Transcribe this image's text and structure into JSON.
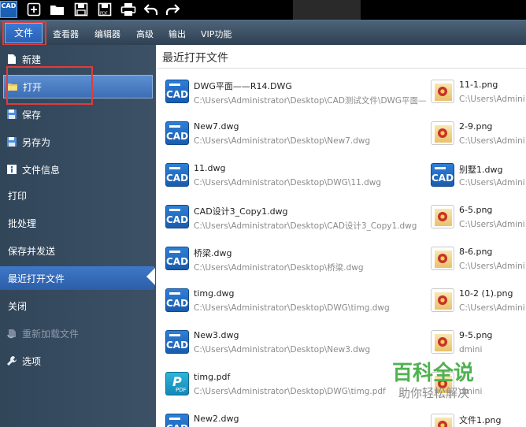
{
  "toolbar": {
    "logo_text": "CAD",
    "icons": [
      "new-icon",
      "open-folder-icon",
      "save-icon",
      "save-pdf-icon",
      "print-icon",
      "undo-icon",
      "redo-icon"
    ]
  },
  "menu": {
    "items": [
      "文件",
      "查看器",
      "编辑器",
      "高级",
      "输出",
      "VIP功能"
    ]
  },
  "sidebar": {
    "items": [
      {
        "label": "新建",
        "icon": "new-file-icon"
      },
      {
        "label": "打开",
        "icon": "open-folder-icon"
      },
      {
        "label": "保存",
        "icon": "save-icon"
      },
      {
        "label": "另存为",
        "icon": "save-as-icon"
      },
      {
        "label": "文件信息",
        "icon": "info-icon"
      },
      {
        "label": "打印"
      },
      {
        "label": "批处理"
      },
      {
        "label": "保存并发送"
      },
      {
        "label": "最近打开文件"
      },
      {
        "label": "关闭"
      },
      {
        "label": "重新加载文件",
        "icon": "reload-icon"
      },
      {
        "label": "选项",
        "icon": "wrench-icon"
      }
    ]
  },
  "recent": {
    "title": "最近打开文件",
    "left_files": [
      {
        "name": "DWG平面——R14.DWG",
        "path": "C:\\Users\\Administrator\\Desktop\\CAD测试文件\\DWG平面—",
        "type": "cad"
      },
      {
        "name": "New7.dwg",
        "path": "C:\\Users\\Administrator\\Desktop\\New7.dwg",
        "type": "cad"
      },
      {
        "name": "11.dwg",
        "path": "C:\\Users\\Administrator\\Desktop\\DWG\\11.dwg",
        "type": "cad"
      },
      {
        "name": "CAD设计3_Copy1.dwg",
        "path": "C:\\Users\\Administrator\\Desktop\\CAD设计3_Copy1.dwg",
        "type": "cad"
      },
      {
        "name": "桥梁.dwg",
        "path": "C:\\Users\\Administrator\\Desktop\\桥梁.dwg",
        "type": "cad"
      },
      {
        "name": "timg.dwg",
        "path": "C:\\Users\\Administrator\\Desktop\\DWG\\timg.dwg",
        "type": "cad"
      },
      {
        "name": "New3.dwg",
        "path": "C:\\Users\\Administrator\\Desktop\\New3.dwg",
        "type": "cad"
      },
      {
        "name": "timg.pdf",
        "path": "C:\\Users\\Administrator\\Desktop\\DWG\\timg.pdf",
        "type": "pdf"
      },
      {
        "name": "New2.dwg",
        "path": "",
        "type": "cad"
      }
    ],
    "right_files": [
      {
        "name": "11-1.png",
        "path": "C:\\Users\\Admini",
        "type": "png"
      },
      {
        "name": "2-9.png",
        "path": "C:\\Users\\Admini",
        "type": "png"
      },
      {
        "name": "别墅1.dwg",
        "path": "C:\\Users\\Admini",
        "type": "cad"
      },
      {
        "name": "6-5.png",
        "path": "C:\\Users\\Admini",
        "type": "png"
      },
      {
        "name": "8-6.png",
        "path": "C:\\Users\\Admini",
        "type": "png"
      },
      {
        "name": "10-2 (1).png",
        "path": "C:\\Users\\Admini",
        "type": "png"
      },
      {
        "name": "9-5.png",
        "path": "dmini",
        "type": "png"
      },
      {
        "name": "",
        "path": "dmini",
        "type": "png"
      },
      {
        "name": "文件1.png",
        "path": "",
        "type": "png"
      }
    ]
  },
  "watermark": {
    "main": "百科全说",
    "sub": "助你轻松解决"
  },
  "colors": {
    "menubar": "#3e5468",
    "sidebar": "#36495d",
    "selected": "#4a7fc8",
    "highlight_box": "#e23b3b",
    "watermark": "#4fb24f"
  }
}
